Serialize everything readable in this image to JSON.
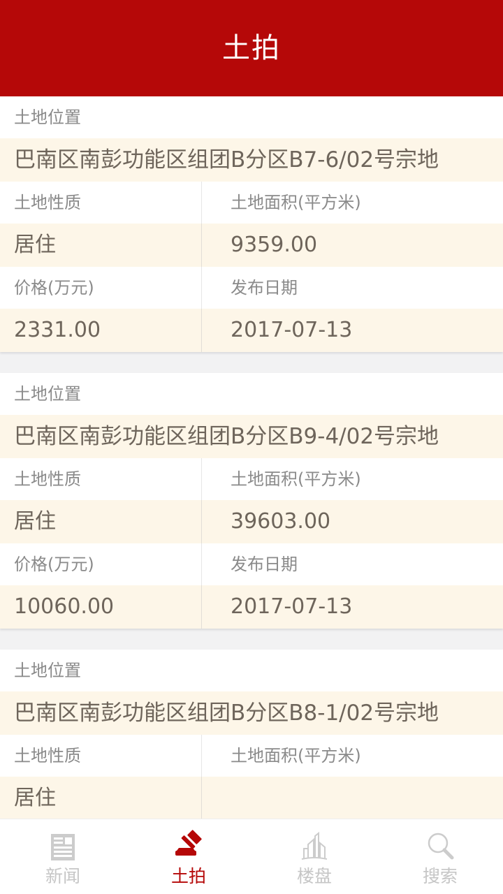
{
  "header": {
    "title": "土拍"
  },
  "labels": {
    "location": "土地位置",
    "nature": "土地性质",
    "area": "土地面积(平方米)",
    "price": "价格(万元)",
    "date": "发布日期"
  },
  "listings": [
    {
      "location": "巴南区南彭功能区组团B分区B7-6/02号宗地",
      "nature": "居住",
      "area": "9359.00",
      "price": "2331.00",
      "date": "2017-07-13"
    },
    {
      "location": "巴南区南彭功能区组团B分区B9-4/02号宗地",
      "nature": "居住",
      "area": "39603.00",
      "price": "10060.00",
      "date": "2017-07-13"
    },
    {
      "location": "巴南区南彭功能区组团B分区B8-1/02号宗地",
      "nature": "居住",
      "area": "",
      "price": "",
      "date": ""
    }
  ],
  "tabbar": {
    "items": [
      {
        "label": "新闻",
        "icon": "newspaper-icon",
        "active": false
      },
      {
        "label": "土拍",
        "icon": "gavel-icon",
        "active": true
      },
      {
        "label": "楼盘",
        "icon": "buildings-icon",
        "active": false
      },
      {
        "label": "搜索",
        "icon": "search-icon",
        "active": false
      }
    ]
  },
  "colors": {
    "header_red": "#b50808",
    "accent_red": "#b50808",
    "value_row_bg": "#fdf6e8",
    "label_row_bg": "#ffffff",
    "page_bg": "#f2f2f3",
    "label_text": "#8a8a8a",
    "value_text": "#6e655b",
    "inactive_tab": "#c6c6c6"
  }
}
